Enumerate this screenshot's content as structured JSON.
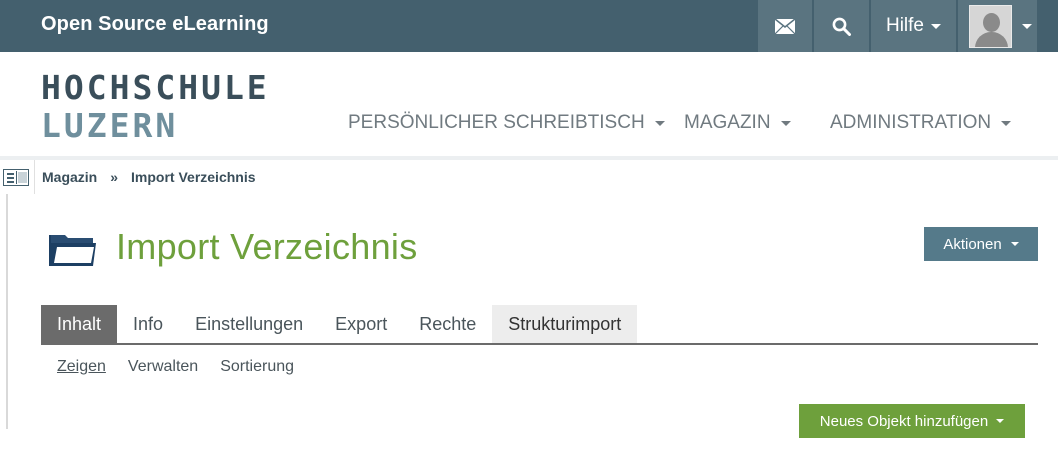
{
  "topbar": {
    "brand": "Open Source eLearning",
    "help_label": "Hilfe",
    "icons": {
      "mail": "mail-icon",
      "search": "search-icon",
      "user": "user-avatar-icon"
    }
  },
  "header": {
    "logo_line1": "HOCHSCHULE",
    "logo_line2": "LUZERN",
    "nav": [
      {
        "label": "PERSÖNLICHER SCHREIBTISCH"
      },
      {
        "label": "MAGAZIN"
      },
      {
        "label": "ADMINISTRATION"
      }
    ]
  },
  "breadcrumb": {
    "items": [
      "Magazin",
      "Import Verzeichnis"
    ],
    "separator": "»"
  },
  "page": {
    "title": "Import Verzeichnis",
    "actions_label": "Aktionen"
  },
  "tabs": [
    {
      "label": "Inhalt",
      "active": true
    },
    {
      "label": "Info"
    },
    {
      "label": "Einstellungen"
    },
    {
      "label": "Export"
    },
    {
      "label": "Rechte"
    },
    {
      "label": "Strukturimport"
    }
  ],
  "subtabs": [
    {
      "label": "Zeigen",
      "active": true
    },
    {
      "label": "Verwalten"
    },
    {
      "label": "Sortierung"
    }
  ],
  "add_button_label": "Neues Objekt hinzufügen",
  "colors": {
    "topbar": "#44606e",
    "accent_green": "#6ea03c",
    "actions_blue": "#557a8a",
    "tab_active": "#6b6b6b"
  }
}
